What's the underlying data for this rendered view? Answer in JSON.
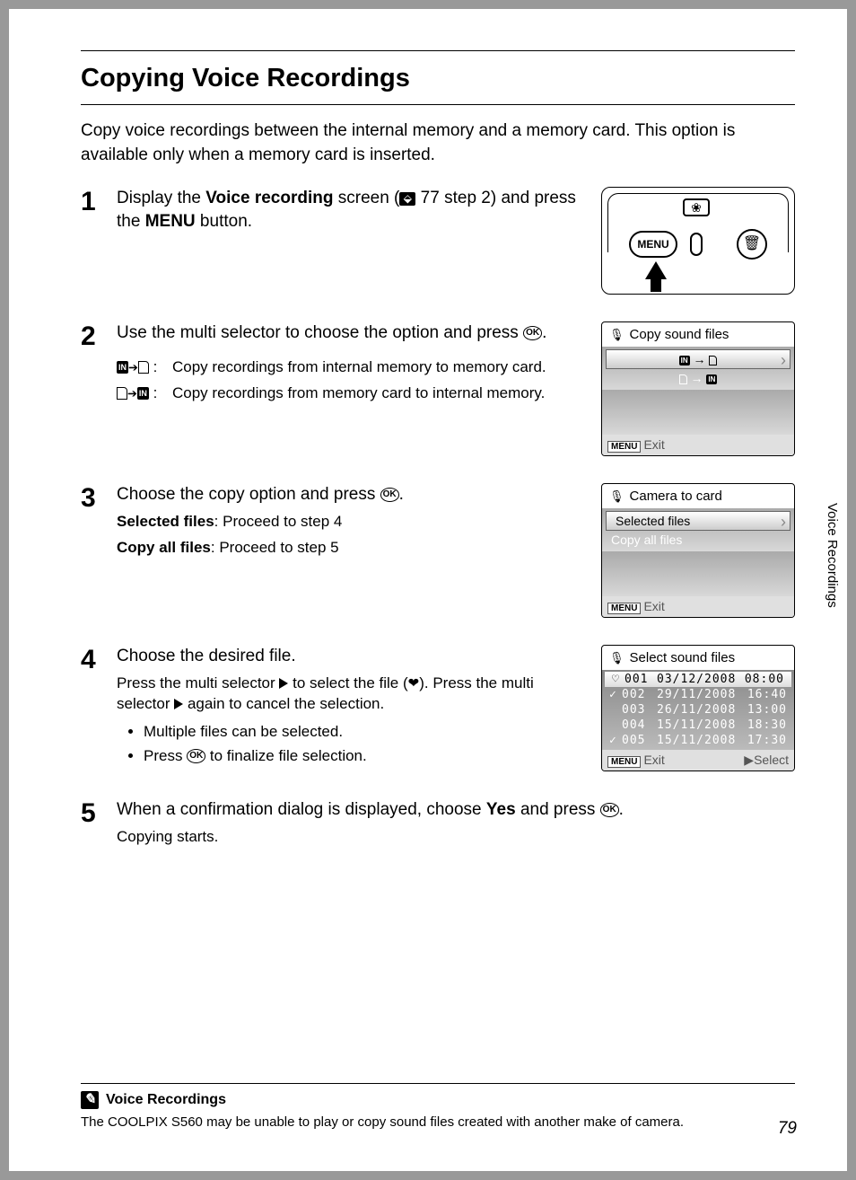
{
  "title": "Copying Voice Recordings",
  "intro": "Copy voice recordings between the internal memory and a memory card. This option is available only when a memory card is inserted.",
  "side_tab": "Voice Recordings",
  "page_number": "79",
  "steps": {
    "s1": {
      "num": "1",
      "text_a": "Display the ",
      "text_b": "Voice recording",
      "text_c": " screen (",
      "page_ref": "77",
      "text_d": "step 2) and press the ",
      "menu_word": "MENU",
      "text_e": " button.",
      "camera_menu": "MENU"
    },
    "s2": {
      "num": "2",
      "text_a": "Use the multi selector to choose the option and press ",
      "ok": "OK",
      "text_b": ".",
      "row1": "Copy recordings from internal memory to memory card.",
      "row2": "Copy recordings from memory card to internal memory.",
      "lcd_title": "Copy sound files",
      "lcd_exit": "Exit"
    },
    "s3": {
      "num": "3",
      "text_a": "Choose the copy option and press ",
      "ok": "OK",
      "text_b": ".",
      "sel_a": "Selected files",
      "sel_b": ": Proceed to step 4",
      "all_a": "Copy all files",
      "all_b": ": Proceed to step 5",
      "lcd_title": "Camera to card",
      "lcd_row1": "Selected files",
      "lcd_row2": "Copy all files",
      "lcd_exit": "Exit"
    },
    "s4": {
      "num": "4",
      "text_a": "Choose the desired file.",
      "body_a": "Press the multi selector ",
      "body_b": " to select the file (",
      "body_c": "). Press the multi selector ",
      "body_d": " again to cancel the selection.",
      "bullet1": "Multiple files can be selected.",
      "bullet2_a": "Press ",
      "bullet2_b": " to finalize file selection.",
      "lcd_title": "Select sound files",
      "files": [
        {
          "chk": "♡",
          "n": "001",
          "d": "03/12/2008",
          "t": "08:00",
          "sel": true
        },
        {
          "chk": "✓",
          "n": "002",
          "d": "29/11/2008",
          "t": "16:40",
          "sel": false
        },
        {
          "chk": "",
          "n": "003",
          "d": "26/11/2008",
          "t": "13:00",
          "sel": false
        },
        {
          "chk": "",
          "n": "004",
          "d": "15/11/2008",
          "t": "18:30",
          "sel": false
        },
        {
          "chk": "✓",
          "n": "005",
          "d": "15/11/2008",
          "t": "17:30",
          "sel": false
        }
      ],
      "lcd_exit": "Exit",
      "lcd_select": "Select"
    },
    "s5": {
      "num": "5",
      "text_a": "When a confirmation dialog is displayed, choose ",
      "text_b": "Yes",
      "text_c": " and press ",
      "ok": "OK",
      "text_d": ".",
      "body": "Copying starts."
    }
  },
  "note": {
    "title": "Voice Recordings",
    "text": "The COOLPIX S560 may be unable to play or copy sound files created with another make of camera."
  }
}
